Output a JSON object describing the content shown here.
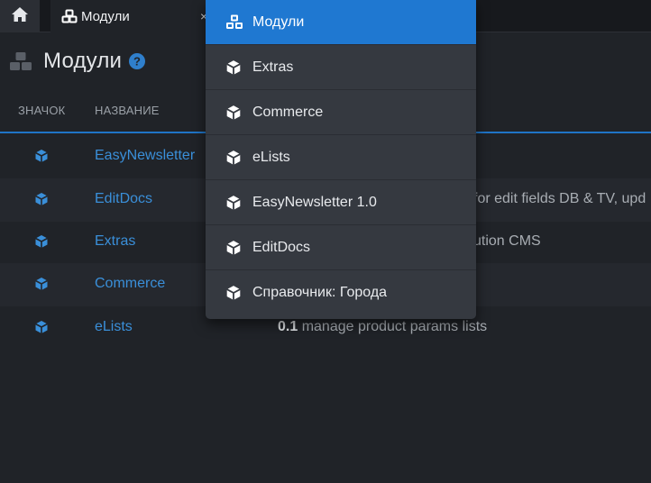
{
  "tabbar": {
    "home_icon": "home-icon",
    "tab_label": "Модули",
    "tab_close": "×"
  },
  "header": {
    "title": "Модули",
    "icon": "cubes-icon",
    "help_icon": "question-circle-icon"
  },
  "table": {
    "columns": [
      "Значок",
      "Название"
    ],
    "rows": [
      {
        "name": "EasyNewsletter",
        "version": "",
        "desc": ""
      },
      {
        "name": "EditDocs",
        "version": "",
        "desc": "for edit fields DB & TV, upd"
      },
      {
        "name": "Extras",
        "version": "",
        "desc": "ution CMS"
      },
      {
        "name": "Commerce",
        "version": "",
        "desc": ""
      },
      {
        "name": "eLists",
        "version": "0.1",
        "desc": "manage product params lists"
      }
    ]
  },
  "dropdown": {
    "items": [
      {
        "label": "Модули",
        "icon": "cubes-icon",
        "active": true
      },
      {
        "label": "Extras",
        "icon": "cube-icon"
      },
      {
        "label": "Commerce",
        "icon": "cube-icon"
      },
      {
        "label": "eLists",
        "icon": "cube-icon"
      },
      {
        "label": "EasyNewsletter 1.0",
        "icon": "cube-icon"
      },
      {
        "label": "EditDocs",
        "icon": "cube-icon"
      },
      {
        "label": "Справочник: Города",
        "icon": "cube-icon"
      }
    ]
  },
  "colors": {
    "accent": "#1f78d1",
    "link": "#3a8fd9",
    "background": "#202328",
    "menu_bg": "#353940"
  }
}
